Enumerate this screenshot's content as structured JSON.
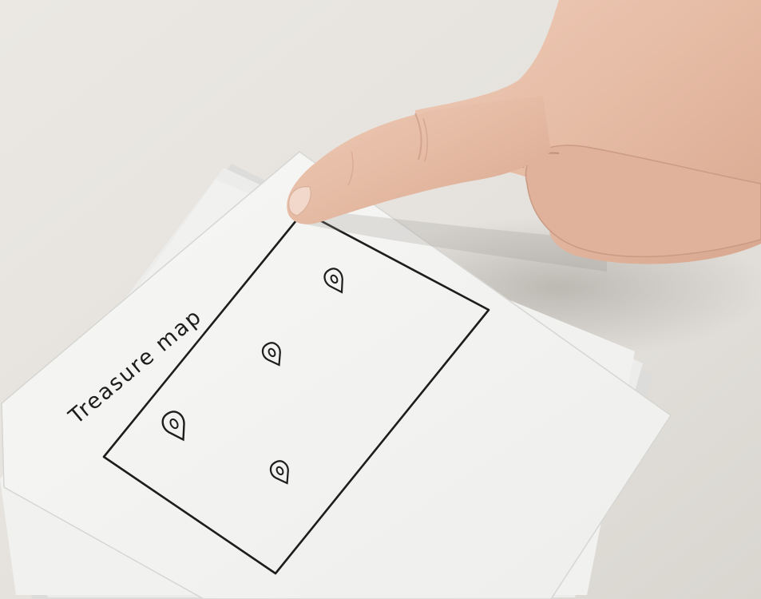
{
  "sketch": {
    "title": "Treasure map",
    "location_pins": [
      "pin",
      "pin",
      "pin",
      "pin"
    ]
  },
  "palette": {
    "desk": "#e6e3de",
    "paper": "#f3f3f1",
    "ink": "#1d1d1d",
    "skin": "#e3b9a3"
  }
}
